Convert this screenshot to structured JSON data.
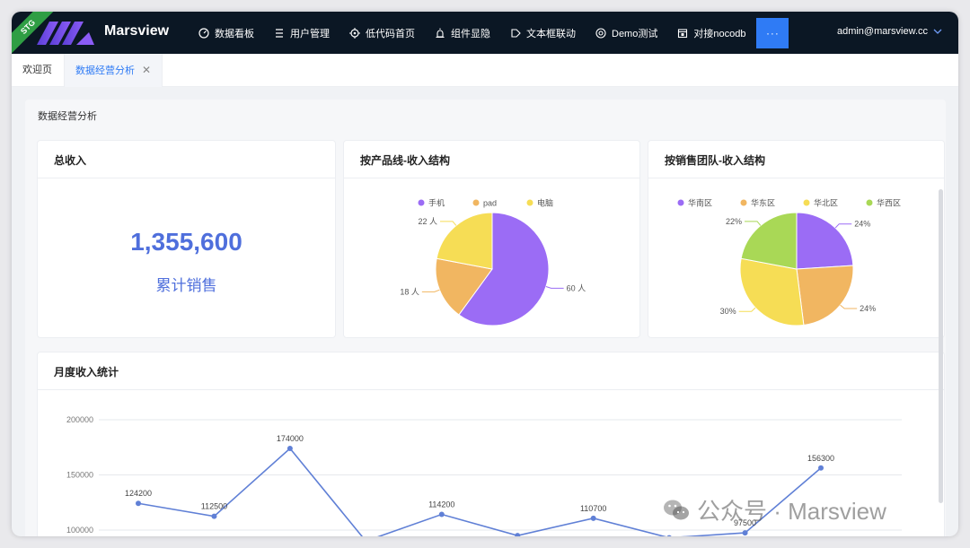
{
  "ribbon": "STG",
  "app_title": "Marsview",
  "nav": [
    {
      "label": "数据看板",
      "icon": "dashboard-icon"
    },
    {
      "label": "用户管理",
      "icon": "user-list-icon"
    },
    {
      "label": "低代码首页",
      "icon": "target-icon"
    },
    {
      "label": "组件显隐",
      "icon": "alarm-icon"
    },
    {
      "label": "文本框联动",
      "icon": "tag-icon"
    },
    {
      "label": "Demo测试",
      "icon": "chrome-icon"
    },
    {
      "label": "对接nocodb",
      "icon": "calendar-icon"
    }
  ],
  "more_label": "···",
  "user": "admin@marsview.cc",
  "tabs": [
    {
      "label": "欢迎页"
    },
    {
      "label": "数据经营分析"
    }
  ],
  "tab_close": "✕",
  "page_title": "数据经营分析",
  "card_total": {
    "title": "总收入",
    "value": "1,355,600",
    "subtitle": "累计销售"
  },
  "card_product": {
    "title": "按产品线-收入结构"
  },
  "card_team": {
    "title": "按销售团队-收入结构"
  },
  "card_monthly": {
    "title": "月度收入统计"
  },
  "watermark": "公众号 · Marsview",
  "colors": {
    "purple": "#9b6cf5",
    "orange": "#f1b661",
    "yellow": "#f6dd55",
    "green": "#a9d856",
    "line": "#6080d6",
    "accent": "#2f7bf5"
  },
  "chart_data": [
    {
      "type": "pie",
      "legend_position": "top",
      "categories": [
        "手机",
        "pad",
        "电脑"
      ],
      "values": [
        60,
        18,
        22
      ],
      "labels": [
        "60 人",
        "18 人",
        "22 人"
      ]
    },
    {
      "type": "pie",
      "legend_position": "top",
      "categories": [
        "华南区",
        "华东区",
        "华北区",
        "华西区"
      ],
      "values": [
        24,
        24,
        30,
        22
      ],
      "labels": [
        "24%",
        "24%",
        "30%",
        "22%"
      ]
    },
    {
      "type": "line",
      "grid": true,
      "ylim": [
        100000,
        200000
      ],
      "y_ticks": [
        "200000",
        "150000",
        "100000"
      ],
      "points": [
        {
          "label": "124200",
          "value": 124200
        },
        {
          "label": "112500",
          "value": 112500
        },
        {
          "label": "174000",
          "value": 174000
        },
        {
          "label": "",
          "value": 90000
        },
        {
          "label": "114200",
          "value": 114200
        },
        {
          "label": "",
          "value": 95000
        },
        {
          "label": "110700",
          "value": 110700
        },
        {
          "label": "",
          "value": 93000
        },
        {
          "label": "97500",
          "value": 97500
        },
        {
          "label": "156300",
          "value": 156300
        }
      ]
    }
  ]
}
